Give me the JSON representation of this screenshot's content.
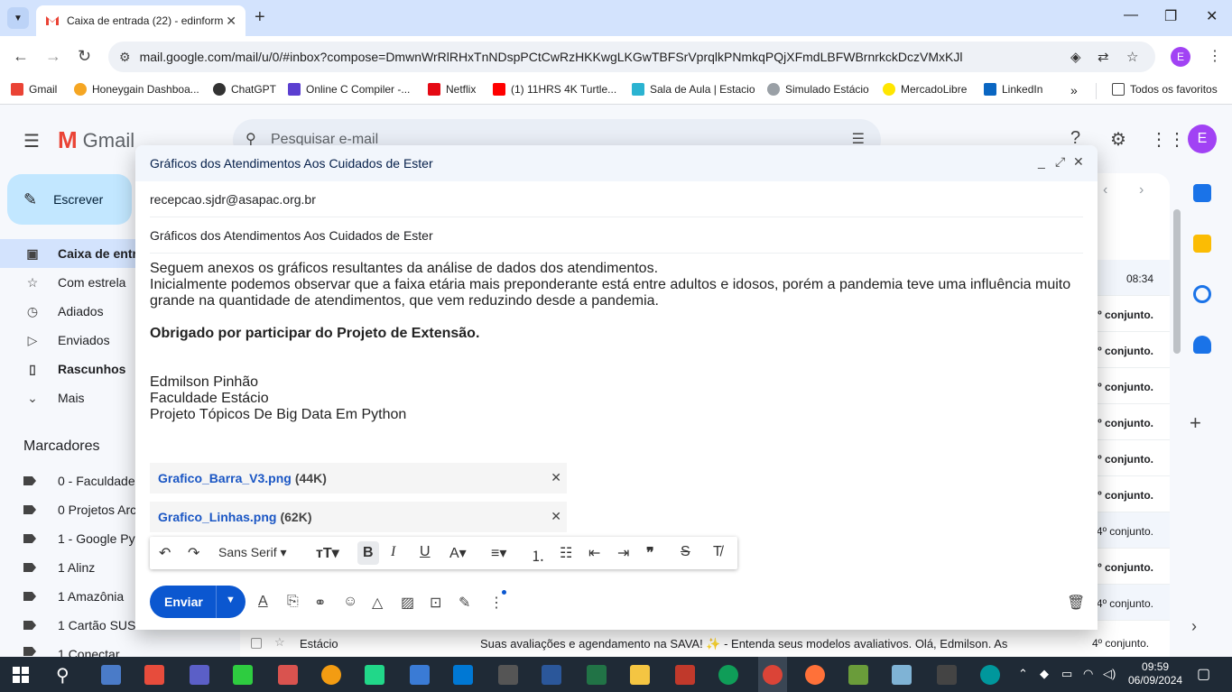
{
  "browser": {
    "tab_title": "Caixa de entrada (22) - edinform",
    "url": "mail.google.com/mail/u/0/#inbox?compose=DmwnWrRlRHxTnNDspPCtCwRzHKKwgLKGwTBFSrVprqlkPNmkqPQjXFmdLBFWBrnrkckDczVMxKJl",
    "profile_initial": "E",
    "bookmarks": [
      "Gmail",
      "Honeygain Dashboa...",
      "ChatGPT",
      "Online C Compiler -...",
      "Netflix",
      "(1) 11HRS 4K Turtle...",
      "Sala de Aula | Estacio",
      "Simulado Estácio",
      "MercadoLibre",
      "LinkedIn"
    ],
    "all_bookmarks": "Todos os favoritos"
  },
  "gmail": {
    "logo_text": "Gmail",
    "search_placeholder": "Pesquisar e-mail",
    "compose_label": "Escrever",
    "avatar_initial": "E",
    "nav": [
      "Caixa de entr",
      "Com estrela",
      "Adiados",
      "Enviados",
      "Rascunhos",
      "Mais"
    ],
    "labels_heading": "Marcadores",
    "labels": [
      "0 - Faculdade",
      "0 Projetos Arc",
      "1 - Google Pyt",
      "1 Alinz",
      "1 Amazônia",
      "1 Cartão SUS",
      "1 Conectar"
    ],
    "row_time": "08:34",
    "row_snippets": [
      "º conjunto.",
      "º conjunto.",
      "º conjunto.",
      "º conjunto.",
      "º conjunto.",
      "º conjunto.",
      "4º conjunto.",
      "º conjunto.",
      "4º conjunto."
    ],
    "bottom_row": {
      "sender": "Estácio",
      "subject": "Suas avaliações e agendamento na SAVA! ✨ - Entenda seus modelos avaliativos. Olá, Edmilson. As",
      "right": "4º conjunto."
    }
  },
  "compose": {
    "title": "Gráficos dos Atendimentos Aos Cuidados de Ester",
    "to": "recepcao.sjdr@asapac.org.br",
    "subject": "Gráficos dos Atendimentos Aos Cuidados de Ester",
    "body_line1": "Seguem anexos os gráficos resultantes da análise de dados dos atendimentos.",
    "body_line2": "Inicialmente podemos observar que a faixa etária mais preponderante está entre adultos e idosos, porém a pandemia teve uma influência muito grande na quantidade de atendimentos, que vem reduzindo desde a pandemia.",
    "body_bold": "Obrigado por participar do Projeto de Extensão.",
    "signature_name": "Edmilson Pinhão",
    "signature_org": "Faculdade Estácio",
    "signature_project": "Projeto Tópicos De Big Data Em Python",
    "attachments": [
      {
        "name": "Grafico_Barra_V3.png",
        "size": "(44K)"
      },
      {
        "name": "Grafico_Linhas.png",
        "size": "(62K)"
      }
    ],
    "font_name": "Sans Serif",
    "send_label": "Enviar"
  },
  "taskbar": {
    "time": "09:59",
    "date": "06/09/2024"
  },
  "colors": {
    "accent": "#0b57d0",
    "compose_button": "#c2e7ff",
    "active_nav": "#d3e3fd",
    "avatar": "#a142f4",
    "taskbar": "#1f2a36"
  }
}
